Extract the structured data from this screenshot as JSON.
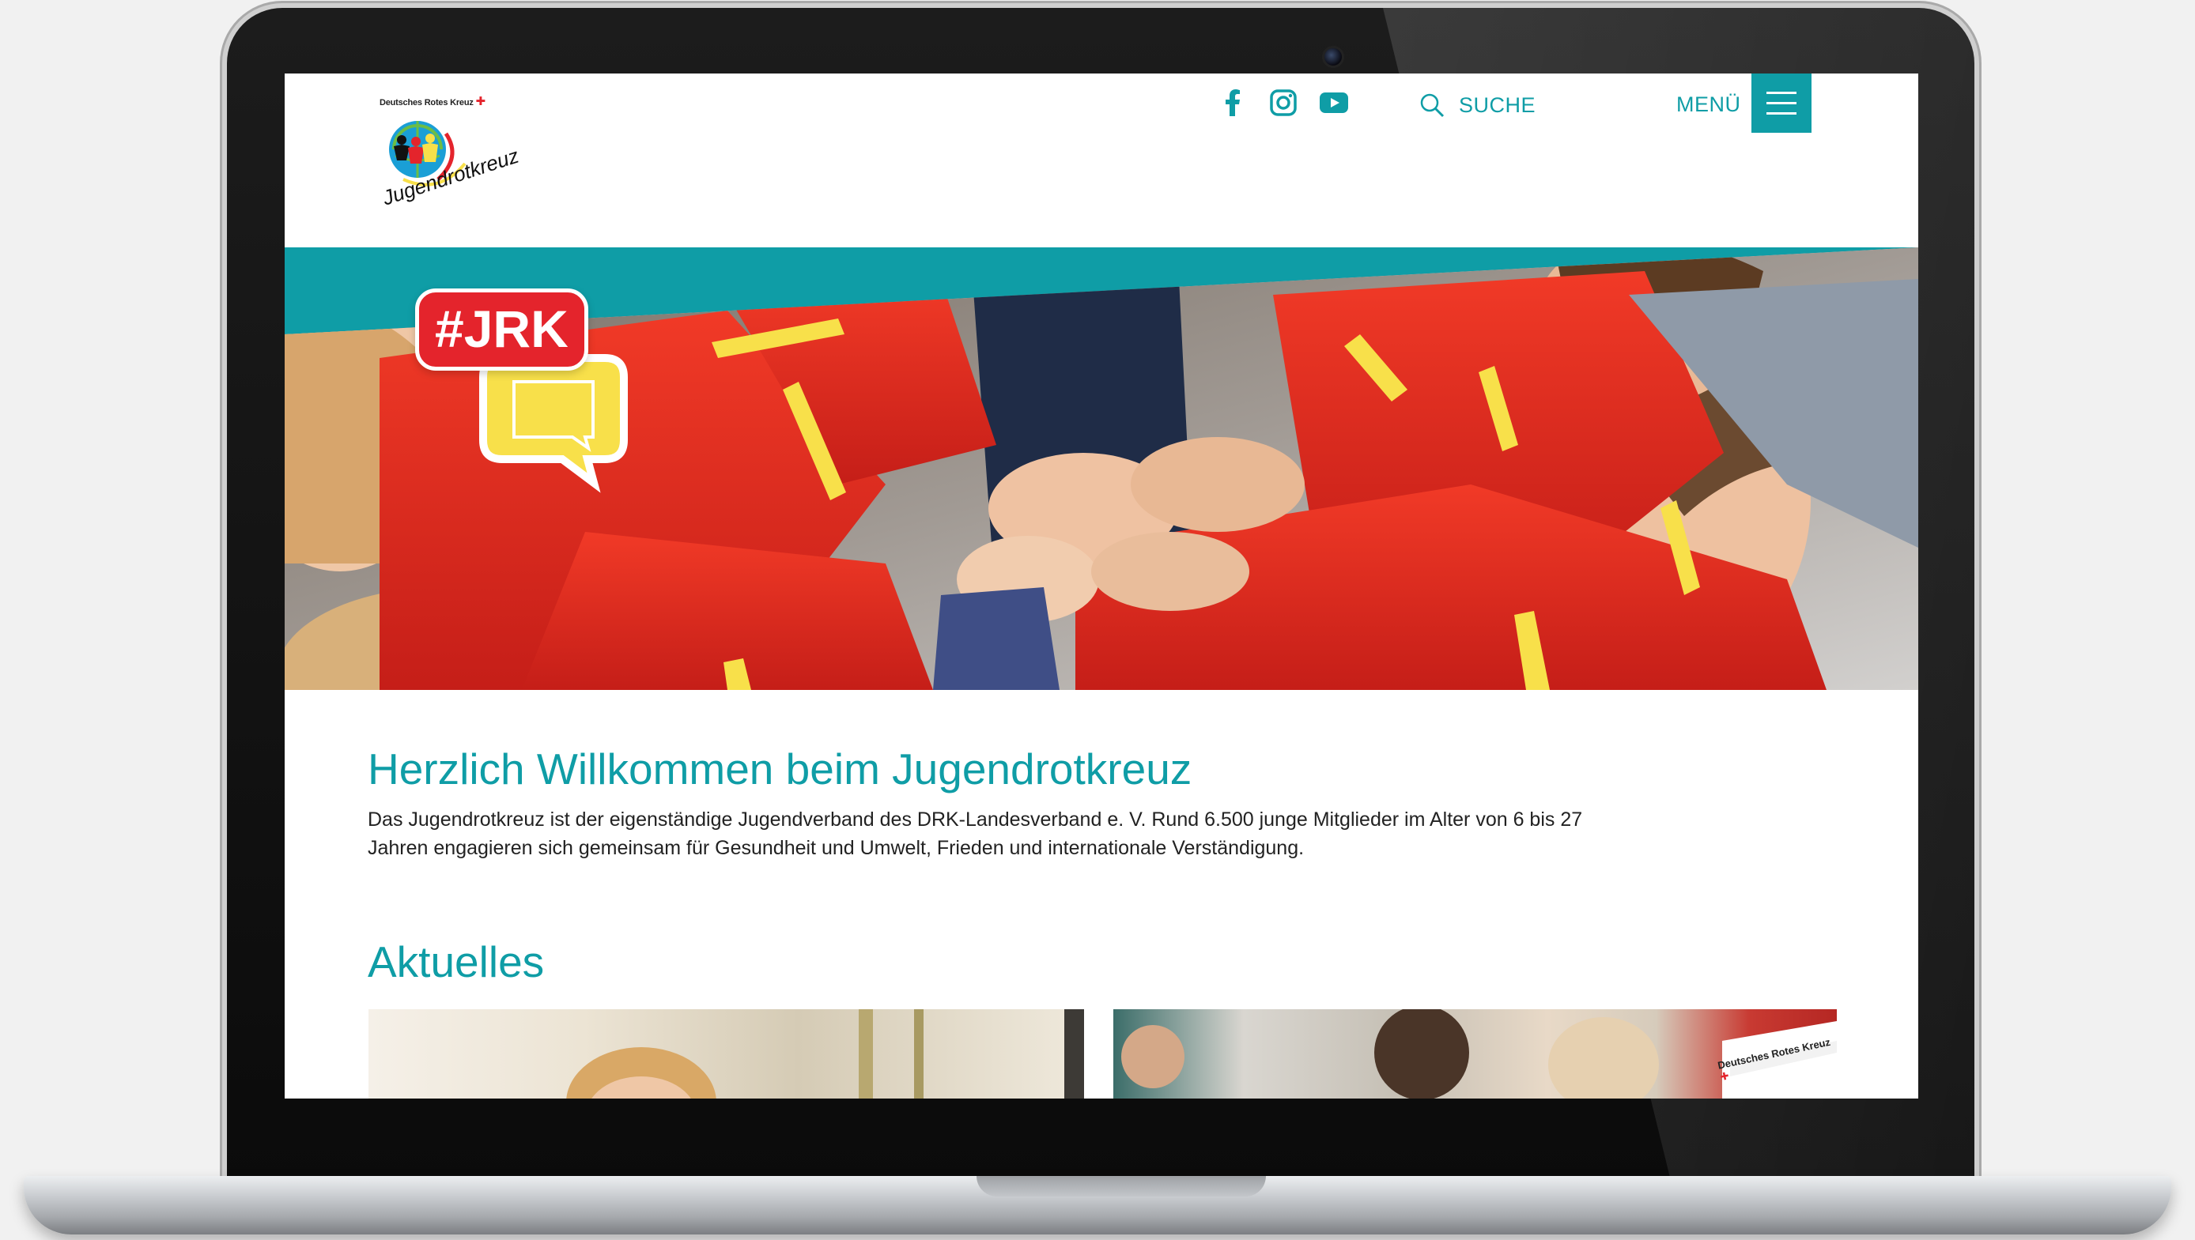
{
  "brand": {
    "caption": "Deutsches Rotes Kreuz",
    "wordmark": "Jugendrotkreuz"
  },
  "header": {
    "social": [
      {
        "icon": "facebook-icon"
      },
      {
        "icon": "instagram-icon"
      },
      {
        "icon": "youtube-icon"
      }
    ],
    "search_label": "SUCHE",
    "menu_label": "MENÜ"
  },
  "hero": {
    "badge": "#JRK"
  },
  "welcome": {
    "title": "Herzlich Willkommen beim Jugendrotkreuz",
    "text_line1": "Das Jugendrotkreuz ist der eigenständige Jugendverband des DRK-Landesverband e. V. Rund 6.500 junge Mitglieder im Alter von 6 bis 27",
    "text_line2": "Jahren engagieren sich gemeinsam für Gesundheit und Umwelt, Frieden und internationale Verständigung."
  },
  "news": {
    "title": "Aktuelles",
    "card2_label": "Deutsches Rotes Kreuz"
  },
  "colors": {
    "accent": "#0f9da6",
    "red": "#e4242c",
    "yellow": "#f8e04a"
  }
}
